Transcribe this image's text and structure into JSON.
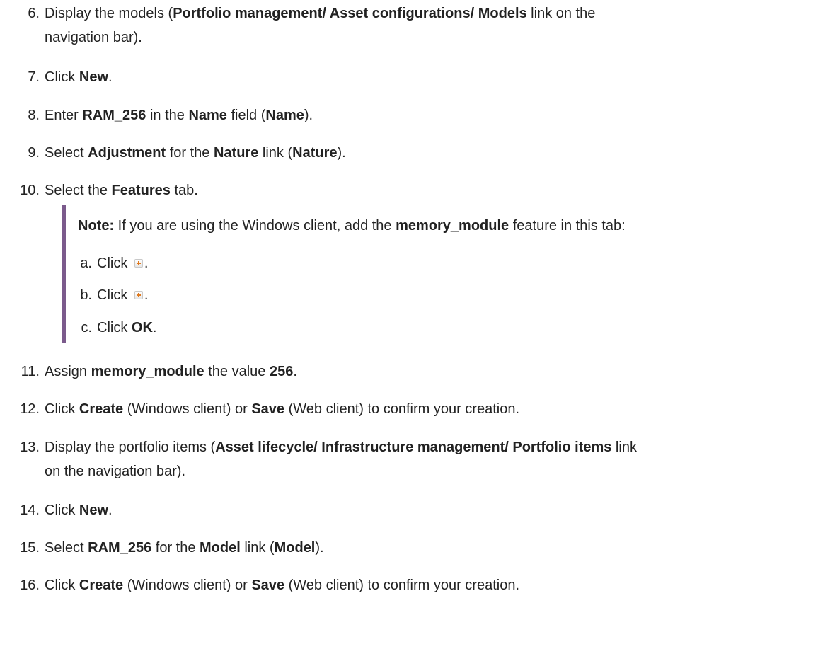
{
  "steps": {
    "s6": {
      "num": "6.",
      "p1": "Display the models (",
      "b1": "Portfolio management/ Asset configurations/ Models",
      "p2": " link on the",
      "line2": "navigation bar)."
    },
    "s7": {
      "num": "7.",
      "p1": "Click ",
      "b1": "New",
      "p2": "."
    },
    "s8": {
      "num": "8.",
      "p1": "Enter ",
      "b1": "RAM_256",
      "p2": " in the ",
      "b2": "Name",
      "p3": " field (",
      "b3": "Name",
      "p4": ")."
    },
    "s9": {
      "num": "9.",
      "p1": "Select ",
      "b1": "Adjustment",
      "p2": " for the ",
      "b2": "Nature",
      "p3": " link (",
      "b3": "Nature",
      "p4": ")."
    },
    "s10": {
      "num": "10.",
      "p1": "Select the ",
      "b1": "Features",
      "p2": " tab."
    },
    "s11": {
      "num": "11.",
      "p1": "Assign ",
      "b1": "memory_module",
      "p2": " the value ",
      "b2": "256",
      "p3": "."
    },
    "s12": {
      "num": "12.",
      "p1": "Click ",
      "b1": "Create",
      "p2": " (Windows client) or ",
      "b2": "Save",
      "p3": " (Web client) to confirm your creation."
    },
    "s13": {
      "num": "13.",
      "p1": "Display the portfolio items (",
      "b1": "Asset lifecycle/ Infrastructure management/ Portfolio items",
      "p2": " link",
      "line2": "on the navigation bar)."
    },
    "s14": {
      "num": "14.",
      "p1": "Click ",
      "b1": "New",
      "p2": "."
    },
    "s15": {
      "num": "15.",
      "p1": "Select ",
      "b1": "RAM_256",
      "p2": " for the ",
      "b2": "Model",
      "p3": " link (",
      "b3": "Model",
      "p4": ")."
    },
    "s16": {
      "num": "16.",
      "p1": "Click ",
      "b1": "Create",
      "p2": " (Windows client) or ",
      "b2": "Save",
      "p3": " (Web client) to confirm your creation."
    }
  },
  "note": {
    "label": "Note:",
    "p1": " If you are using the Windows client, add the ",
    "b1": "memory_module",
    "p2": " feature in this tab:",
    "a": {
      "letter": "a.",
      "p1": "Click ",
      "p2": "."
    },
    "b": {
      "letter": "b.",
      "p1": "Click ",
      "p2": "."
    },
    "c": {
      "letter": "c.",
      "p1": "Click ",
      "b1": "OK",
      "p2": "."
    }
  },
  "icons": {
    "add": "add-icon"
  },
  "colors": {
    "note_bar": "#7b5a8c",
    "icon_plus": "#e07a1f"
  }
}
